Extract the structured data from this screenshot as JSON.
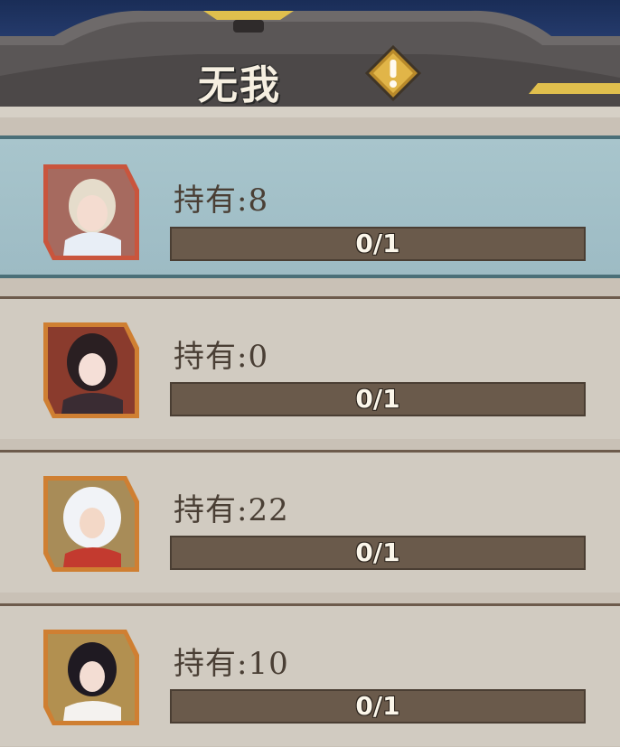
{
  "header": {
    "title": "无我",
    "info_icon": "exclamation-diamond-icon"
  },
  "colors": {
    "selected_row": "#a8c5cc",
    "bar_track": "#6a5a4b",
    "frame_accent": "#d9b23a"
  },
  "characters": [
    {
      "name": "blonde-girl-card",
      "holding_label": "持有:8",
      "progress_text": "0/1",
      "progress": 0,
      "selected": true
    },
    {
      "name": "dark-hair-girl-card",
      "holding_label": "持有:0",
      "progress_text": "0/1",
      "progress": 0,
      "selected": false
    },
    {
      "name": "inuyasha-card",
      "holding_label": "持有:22",
      "progress_text": "0/1",
      "progress": 0,
      "selected": false
    },
    {
      "name": "kikyo-card",
      "holding_label": "持有:10",
      "progress_text": "0/1",
      "progress": 0,
      "selected": false
    }
  ]
}
